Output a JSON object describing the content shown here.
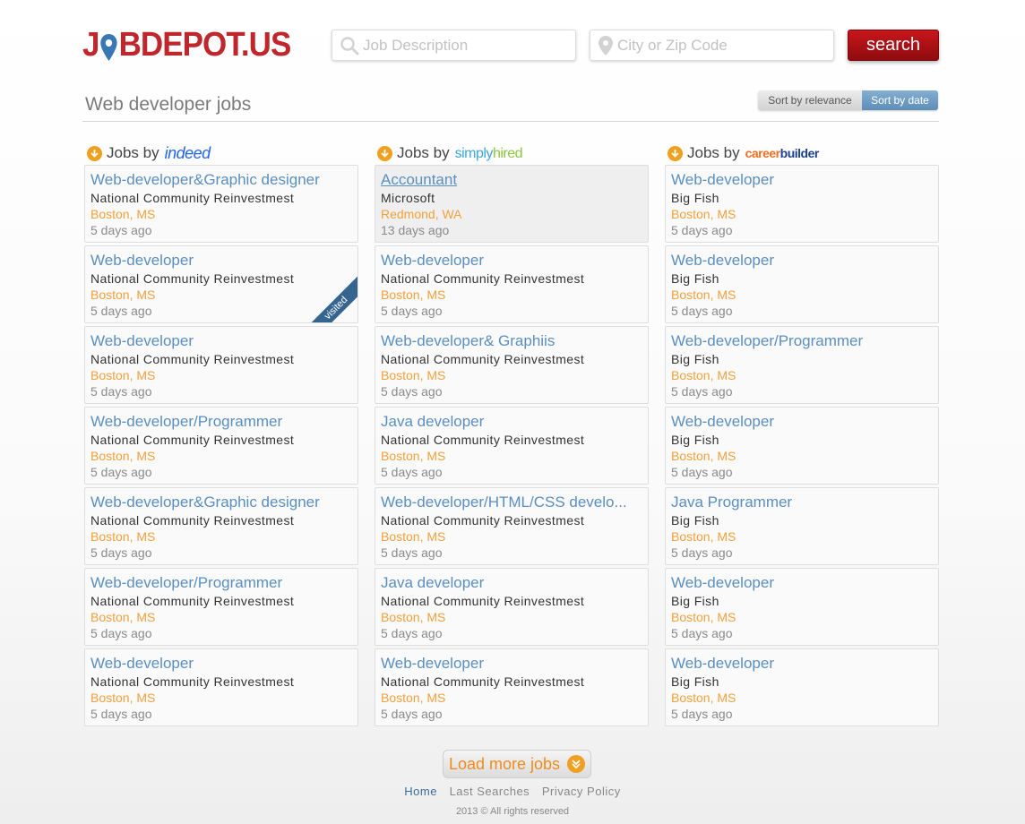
{
  "header": {
    "logo_text_a": "J",
    "logo_text_b": "BDEPOT.US",
    "job_placeholder": "Job Description",
    "city_placeholder": "City or Zip Code",
    "search_label": "search"
  },
  "title": "Web developer jobs",
  "sort": {
    "relevance_label": "Sort by relevance",
    "date_label": "Sort by date",
    "active": "date"
  },
  "colors": {
    "brand_red": "#c0272d",
    "link_blue": "#5b8fc0",
    "location_orange": "#f2a03b",
    "accent_orange": "#f0a020",
    "sort_active": "#5d8db8"
  },
  "columns": [
    {
      "jobs_by": "Jobs by",
      "brand": "indeed",
      "jobs": [
        {
          "title": "Web-developer&Graphic designer",
          "company": "National Community Reinvestmest",
          "location": "Boston, MS",
          "age": "5 days ago"
        },
        {
          "title": "Web-developer",
          "company": "National Community Reinvestmest",
          "location": "Boston, MS",
          "age": "5 days ago",
          "visited": "visited"
        },
        {
          "title": "Web-developer",
          "company": "National Community Reinvestmest",
          "location": "Boston, MS",
          "age": "5 days ago"
        },
        {
          "title": "Web-developer/Programmer",
          "company": "National Community Reinvestmest",
          "location": "Boston, MS",
          "age": "5 days ago"
        },
        {
          "title": "Web-developer&Graphic designer",
          "company": "National Community Reinvestmest",
          "location": "Boston, MS",
          "age": "5 days ago"
        },
        {
          "title": "Web-developer/Programmer",
          "company": "National Community Reinvestmest",
          "location": "Boston, MS",
          "age": "5 days ago"
        },
        {
          "title": "Web-developer",
          "company": "National Community Reinvestmest",
          "location": "Boston, MS",
          "age": "5 days ago"
        }
      ]
    },
    {
      "jobs_by": "Jobs by",
      "brand_a": "simply",
      "brand_b": "hired",
      "jobs": [
        {
          "title": "Accountant",
          "company": "Microsoft",
          "location": "Redmond, WA",
          "age": "13 days ago"
        },
        {
          "title": "Web-developer",
          "company": "National Community Reinvestmest",
          "location": "Boston, MS",
          "age": "5 days ago"
        },
        {
          "title": "Web-developer& Graphiis",
          "company": "National Community Reinvestmest",
          "location": "Boston, MS",
          "age": "5 days ago"
        },
        {
          "title": "Java developer",
          "company": "National Community Reinvestmest",
          "location": "Boston, MS",
          "age": "5 days ago"
        },
        {
          "title": "Web-developer/HTML/CSS develo...",
          "company": "National Community Reinvestmest",
          "location": "Boston, MS",
          "age": "5 days ago"
        },
        {
          "title": "Java developer",
          "company": "National Community Reinvestmest",
          "location": "Boston, MS",
          "age": "5 days ago"
        },
        {
          "title": "Web-developer",
          "company": "National Community Reinvestmest",
          "location": "Boston, MS",
          "age": "5 days ago"
        }
      ]
    },
    {
      "jobs_by": "Jobs by",
      "brand_a": "career",
      "brand_b": "builder",
      "jobs": [
        {
          "title": "Web-developer",
          "company": "Big Fish",
          "location": "Boston, MS",
          "age": "5 days ago"
        },
        {
          "title": "Web-developer",
          "company": "Big Fish",
          "location": "Boston, MS",
          "age": "5 days ago"
        },
        {
          "title": "Web-developer/Programmer",
          "company": "Big Fish",
          "location": "Boston, MS",
          "age": "5 days ago"
        },
        {
          "title": "Web-developer",
          "company": "Big Fish",
          "location": "Boston, MS",
          "age": "5 days ago"
        },
        {
          "title": "Java Programmer",
          "company": "Big Fish",
          "location": "Boston, MS",
          "age": "5 days ago"
        },
        {
          "title": "Web-developer",
          "company": "Big Fish",
          "location": "Boston, MS",
          "age": "5 days ago"
        },
        {
          "title": "Web-developer",
          "company": "Big Fish",
          "location": "Boston, MS",
          "age": "5 days ago"
        }
      ]
    }
  ],
  "load_more": "Load more jobs",
  "footer": {
    "links": [
      "Home",
      "Last Searches",
      "Privacy Policy"
    ],
    "copyright": "2013 © All rights reserved"
  }
}
